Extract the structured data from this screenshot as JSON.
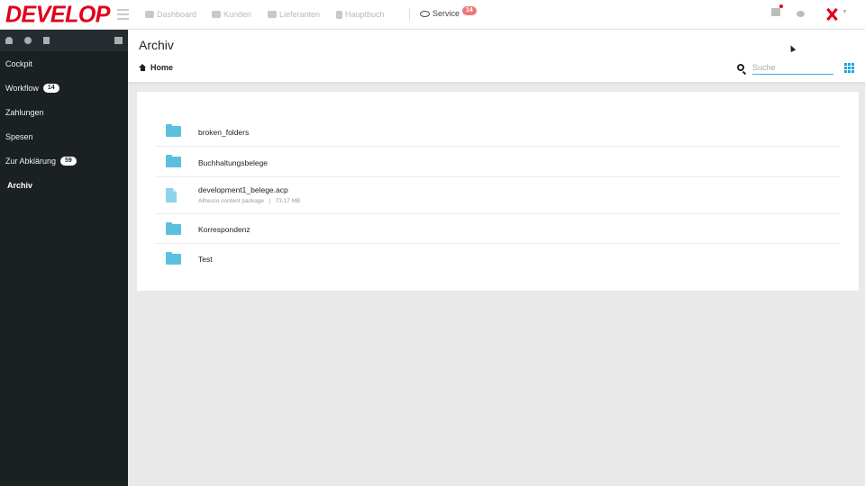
{
  "brand": {
    "logo": "DEVELOP",
    "logo_color": "#e2001a"
  },
  "topnav": {
    "items": [
      {
        "label": "Dashboard",
        "icon": "dashboard-icon"
      },
      {
        "label": "Kunden",
        "icon": "users-icon"
      },
      {
        "label": "Lieferanten",
        "icon": "truck-icon"
      },
      {
        "label": "Hauptbuch",
        "icon": "book-icon"
      }
    ],
    "service": {
      "label": "Service",
      "badge": "14",
      "icon": "eye-icon"
    }
  },
  "sidebar": {
    "icons": [
      "bell-icon",
      "gear-icon",
      "book-icon",
      "list-icon"
    ],
    "items": [
      {
        "label": "Cockpit",
        "badge": ""
      },
      {
        "label": "Workflow",
        "badge": "14"
      },
      {
        "label": "Zahlungen",
        "badge": ""
      },
      {
        "label": "Spesen",
        "badge": ""
      },
      {
        "label": "Zur Abklärung",
        "badge": "59"
      },
      {
        "label": "Archiv",
        "badge": "",
        "active": true
      }
    ]
  },
  "header": {
    "title": "Archiv",
    "breadcrumb": "Home",
    "search_placeholder": "Suche",
    "accent_color": "#1fa7dc"
  },
  "files": [
    {
      "name": "broken_folders",
      "type": "folder"
    },
    {
      "name": "Buchhaltungsbelege",
      "type": "folder"
    },
    {
      "name": "development1_belege.acp",
      "type": "file",
      "kind": "Alfresco content package",
      "size": "73.17 MB"
    },
    {
      "name": "Korrespondenz",
      "type": "folder"
    },
    {
      "name": "Test",
      "type": "folder"
    }
  ]
}
